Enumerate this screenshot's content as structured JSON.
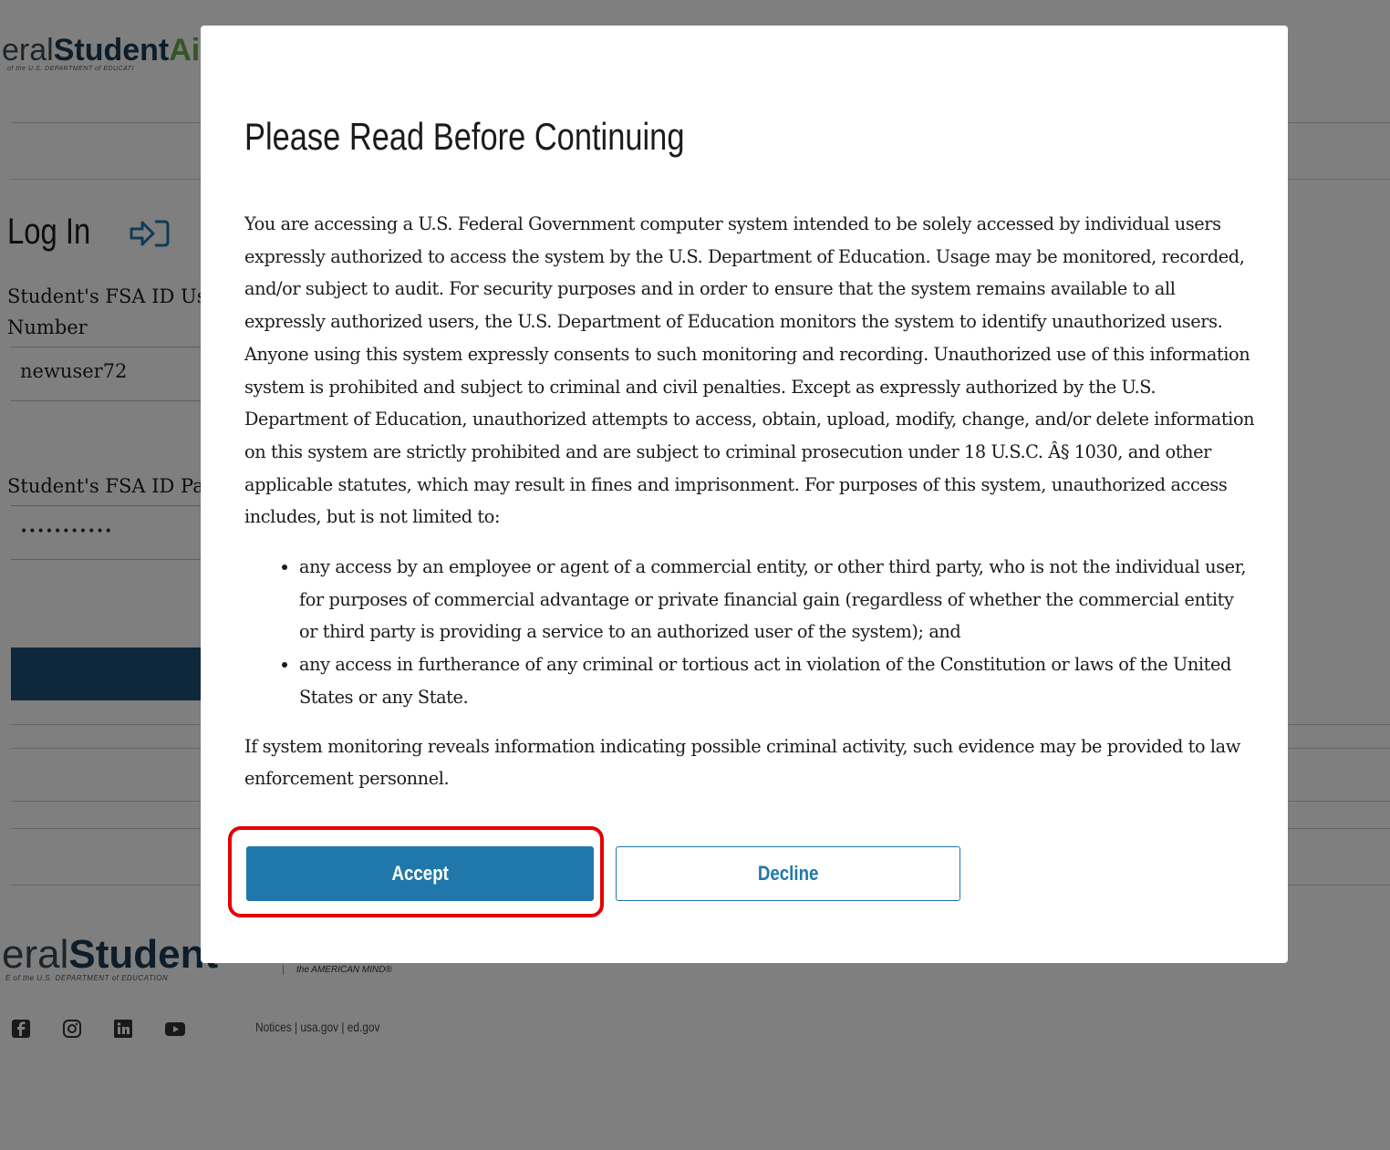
{
  "header": {
    "brand_fed": "eral",
    "brand_student": "Student",
    "brand_aid": "Ai",
    "brand_sub": "of the U.S. DEPARTMENT of EDUCATI"
  },
  "login": {
    "title": "Log In",
    "username_label_1": "Student's FSA ID Us",
    "username_label_2": "Number",
    "username_value": "newuser72",
    "password_label": "Student's FSA ID Pa",
    "password_value": "•••••••••••"
  },
  "footer": {
    "brand_fed": "eral",
    "brand_student": "Student",
    "brand_sub": "E of the U.S. DEPARTMENT of EDUCATION",
    "tagline": "the AMERICAN MIND®",
    "social": [
      "facebook-icon",
      "instagram-icon",
      "linkedin-icon",
      "youtube-icon"
    ],
    "links": "Notices  |  usa.gov  |  ed.gov"
  },
  "modal": {
    "title": "Please Read Before Continuing",
    "paragraph1": "You are accessing a U.S. Federal Government computer system intended to be solely accessed by individual users expressly authorized to access the system by the U.S. Department of Education. Usage may be monitored, recorded, and/or subject to audit. For security purposes and in order to ensure that the system remains available to all expressly authorized users, the U.S. Department of Education monitors the system to identify unauthorized users. Anyone using this system expressly consents to such monitoring and recording. Unauthorized use of this information system is prohibited and subject to criminal and civil penalties. Except as expressly authorized by the U.S. Department of Education, unauthorized attempts to access, obtain, upload, modify, change, and/or delete information on this system are strictly prohibited and are subject to criminal prosecution under 18 U.S.C. Â§ 1030, and other applicable statutes, which may result in fines and imprisonment. For purposes of this system, unauthorized access includes, but is not limited to:",
    "bullets": [
      "any access by an employee or agent of a commercial entity, or other third party, who is not the individual user, for purposes of commercial advantage or private financial gain (regardless of whether the commercial entity or third party is providing a service to an authorized user of the system); and",
      "any access in furtherance of any criminal or tortious act in violation of the Constitution or laws of the United States or any State."
    ],
    "paragraph2": "If system monitoring reveals information indicating possible criminal activity, such evidence may be provided to law enforcement personnel.",
    "accept_label": "Accept",
    "decline_label": "Decline"
  },
  "colors": {
    "accept_bg": "#2078aa",
    "highlight": "#e30000",
    "login_button": "#1f4f76"
  }
}
